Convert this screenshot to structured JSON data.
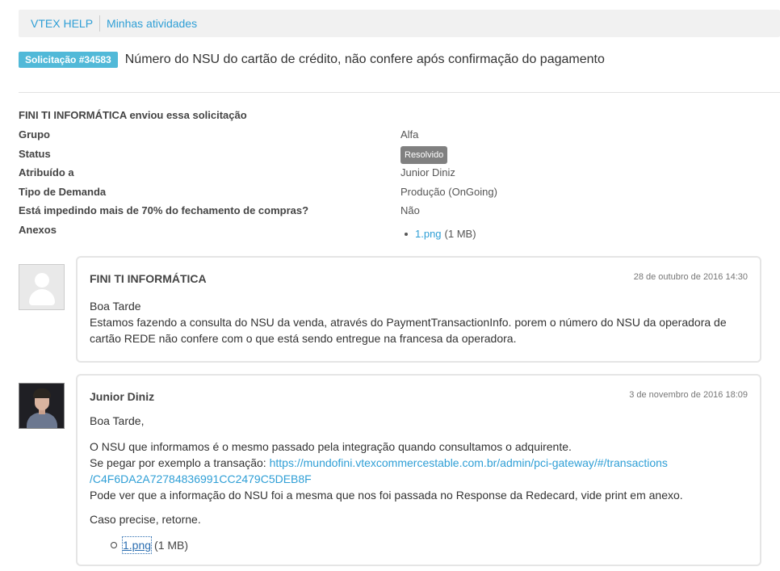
{
  "breadcrumb": {
    "home": "VTEX HELP",
    "current": "Minhas atividades"
  },
  "ticket": {
    "badge": "Solicitação #34583",
    "title": "Número do NSU do cartão de crédito, não confere após confirmação do pagamento"
  },
  "details": {
    "requester_line": "FINI TI INFORMÁTICA enviou essa solicitação",
    "fields": [
      {
        "label": "Grupo",
        "value": "Alfa"
      },
      {
        "label": "Status",
        "value": "Resolvido"
      },
      {
        "label": "Atribuído a",
        "value": "Junior Diniz"
      },
      {
        "label": "Tipo de Demanda",
        "value": "Produção (OnGoing)"
      },
      {
        "label": "Está impedindo mais de 70% do fechamento de compras?",
        "value": "Não"
      },
      {
        "label": "Anexos",
        "value": ""
      }
    ],
    "attachment": {
      "name": "1.png",
      "size": "(1 MB)"
    }
  },
  "comments": [
    {
      "author": "FINI TI INFORMÁTICA",
      "date": "28 de outubro de 2016 14:30",
      "line1": "Boa Tarde",
      "line2": "Estamos fazendo a consulta do NSU da venda, através do PaymentTransactionInfo. porem o número do NSU da operadora de cartão REDE não confere com o que está sendo entregue na francesa da operadora."
    },
    {
      "author": "Junior Diniz",
      "date": "3 de novembro de 2016 18:09",
      "greeting": "Boa Tarde,",
      "p1": "O NSU que informamos é o mesmo passado pela integração quando consultamos o adquirente.",
      "p2_prefix": "Se pegar por exemplo a transação:",
      "link_part1": "https://mundofini.vtexcommercestable.com.br/admin/pci-gateway/#/transactions",
      "link_part2": "/C4F6DA2A72784836991CC2479C5DEB8F",
      "p3": "Pode ver que a informação do NSU foi a mesma que nos foi passada no Response da Redecard, vide print em anexo.",
      "p4": "Caso precise, retorne.",
      "attachment": {
        "name": "1.png",
        "size": "(1 MB)"
      }
    }
  ],
  "colors": {
    "accent": "#51b9d8",
    "link": "#2f9fd6",
    "status_badge": "#808080"
  }
}
